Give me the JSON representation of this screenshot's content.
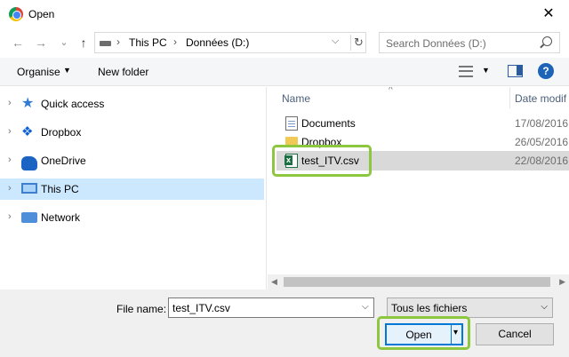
{
  "window": {
    "title": "Open",
    "close_glyph": "✕"
  },
  "nav_buttons": {
    "back": "←",
    "forward": "→",
    "recent": "⌄",
    "up": "↑"
  },
  "address": {
    "crumbs": [
      "This PC",
      "Données (D:)"
    ],
    "sep": "›",
    "dropdown": "⌵",
    "refresh": "↻"
  },
  "search": {
    "placeholder": "Search Données (D:)"
  },
  "toolbar": {
    "organise": "Organise",
    "new_folder": "New folder",
    "caret": "▼"
  },
  "nav_pane": {
    "chevron": "›",
    "items": [
      {
        "label": "Quick access",
        "icon": "star-icon",
        "glyph": "★"
      },
      {
        "label": "Dropbox",
        "icon": "dropbox-icon",
        "glyph": "❖"
      },
      {
        "label": "OneDrive",
        "icon": "cloud-icon"
      },
      {
        "label": "This PC",
        "icon": "computer-icon",
        "selected": true
      },
      {
        "label": "Network",
        "icon": "network-icon"
      }
    ]
  },
  "file_list": {
    "sort_caret": "^",
    "columns": {
      "name": "Name",
      "date": "Date modif"
    },
    "rows": [
      {
        "name": "Documents",
        "date": "17/08/2016",
        "icon": "document-icon"
      },
      {
        "name": "Dropbox",
        "date": "26/05/2016",
        "icon": "folder-icon"
      },
      {
        "name": "test_ITV.csv",
        "date": "22/08/2016",
        "icon": "excel-csv-icon",
        "selected": true
      }
    ]
  },
  "scrollbar": {
    "left": "◀",
    "right": "▶"
  },
  "footer": {
    "file_name_label": "File name:",
    "file_name_value": "test_ITV.csv",
    "dropdown": "⌵",
    "filter": "Tous les fichiers",
    "open": "Open",
    "open_dd": "▾",
    "cancel": "Cancel"
  },
  "colors": {
    "selection": "#cce8ff",
    "highlight": "#8dc63f",
    "accent": "#0078d7"
  }
}
